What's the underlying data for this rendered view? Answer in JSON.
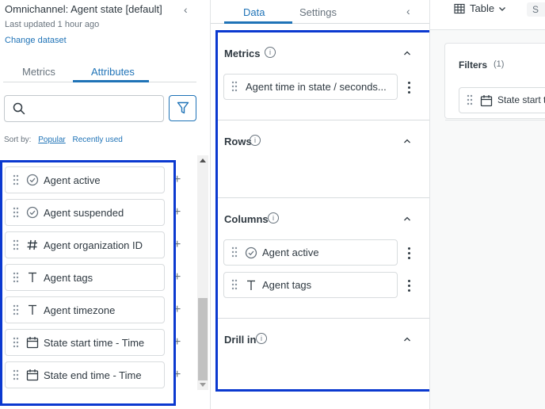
{
  "dataset": {
    "title": "Omnichannel: Agent state [default]",
    "last_updated": "Last updated 1 hour ago",
    "change_link": "Change dataset",
    "collapse_glyph": "‹"
  },
  "left_tabs": [
    {
      "label": "Metrics",
      "active": false
    },
    {
      "label": "Attributes",
      "active": true
    }
  ],
  "search": {
    "placeholder": "",
    "icon": "search-icon"
  },
  "sort": {
    "label": "Sort by:",
    "options": [
      "Popular",
      "Recently used"
    ],
    "selected": "Popular"
  },
  "attributes": [
    {
      "label": "Agent active",
      "icon": "check-circle-icon"
    },
    {
      "label": "Agent suspended",
      "icon": "check-circle-icon"
    },
    {
      "label": "Agent organization ID",
      "icon": "hash-icon"
    },
    {
      "label": "Agent tags",
      "icon": "text-type-icon"
    },
    {
      "label": "Agent timezone",
      "icon": "text-type-icon"
    },
    {
      "label": "State start time - Time",
      "icon": "calendar-icon"
    },
    {
      "label": "State end time - Time",
      "icon": "calendar-icon"
    }
  ],
  "add_glyph": "+",
  "mid_tabs": [
    {
      "label": "Data",
      "active": true
    },
    {
      "label": "Settings",
      "active": false
    }
  ],
  "sections": {
    "metrics": {
      "title": "Metrics",
      "fields": [
        {
          "label": "Agent time in state / seconds...",
          "icon": "none"
        }
      ]
    },
    "rows": {
      "title": "Rows",
      "fields": []
    },
    "columns": {
      "title": "Columns",
      "fields": [
        {
          "label": "Agent active",
          "icon": "check-circle-icon"
        },
        {
          "label": "Agent tags",
          "icon": "text-type-icon"
        }
      ]
    },
    "drill_in": {
      "title": "Drill in",
      "fields": []
    }
  },
  "info_glyph": "i",
  "visualization": {
    "type_label": "Table",
    "type_icon": "table-icon",
    "next_fragment": "S"
  },
  "filters": {
    "title": "Filters",
    "count": "(1)",
    "chips": [
      {
        "label": "State start ti",
        "icon": "calendar-icon"
      }
    ]
  },
  "colors": {
    "accent": "#1f73b7",
    "highlight": "#0b39d0",
    "text": "#2f3941",
    "muted": "#68737d"
  }
}
